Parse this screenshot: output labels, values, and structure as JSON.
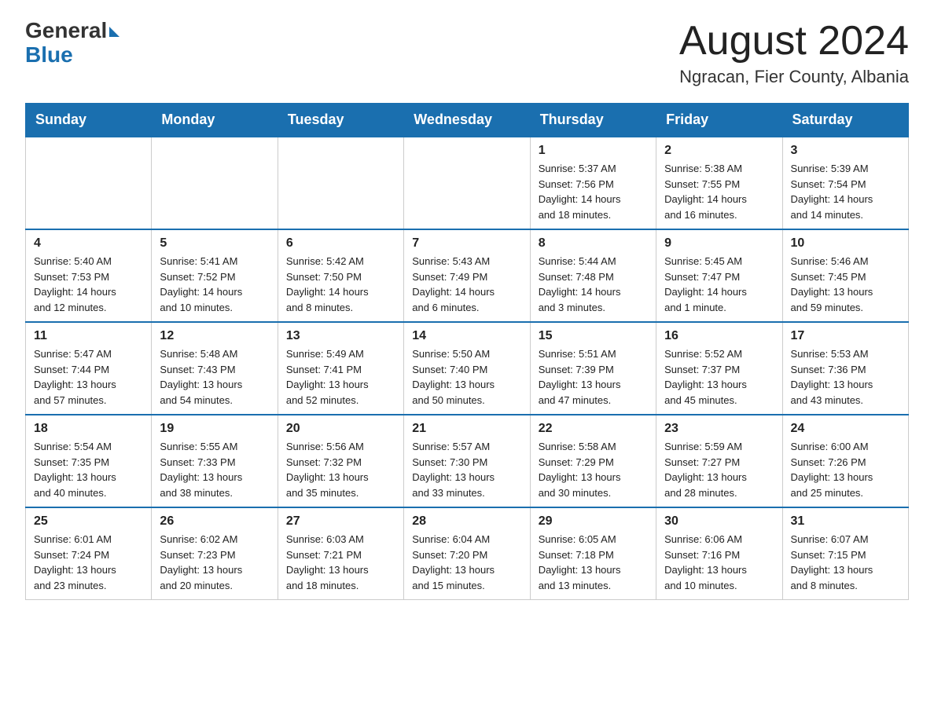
{
  "header": {
    "logo_general": "General",
    "logo_blue": "Blue",
    "month_title": "August 2024",
    "location": "Ngracan, Fier County, Albania"
  },
  "weekdays": [
    "Sunday",
    "Monday",
    "Tuesday",
    "Wednesday",
    "Thursday",
    "Friday",
    "Saturday"
  ],
  "weeks": [
    [
      {
        "day": "",
        "info": ""
      },
      {
        "day": "",
        "info": ""
      },
      {
        "day": "",
        "info": ""
      },
      {
        "day": "",
        "info": ""
      },
      {
        "day": "1",
        "info": "Sunrise: 5:37 AM\nSunset: 7:56 PM\nDaylight: 14 hours\nand 18 minutes."
      },
      {
        "day": "2",
        "info": "Sunrise: 5:38 AM\nSunset: 7:55 PM\nDaylight: 14 hours\nand 16 minutes."
      },
      {
        "day": "3",
        "info": "Sunrise: 5:39 AM\nSunset: 7:54 PM\nDaylight: 14 hours\nand 14 minutes."
      }
    ],
    [
      {
        "day": "4",
        "info": "Sunrise: 5:40 AM\nSunset: 7:53 PM\nDaylight: 14 hours\nand 12 minutes."
      },
      {
        "day": "5",
        "info": "Sunrise: 5:41 AM\nSunset: 7:52 PM\nDaylight: 14 hours\nand 10 minutes."
      },
      {
        "day": "6",
        "info": "Sunrise: 5:42 AM\nSunset: 7:50 PM\nDaylight: 14 hours\nand 8 minutes."
      },
      {
        "day": "7",
        "info": "Sunrise: 5:43 AM\nSunset: 7:49 PM\nDaylight: 14 hours\nand 6 minutes."
      },
      {
        "day": "8",
        "info": "Sunrise: 5:44 AM\nSunset: 7:48 PM\nDaylight: 14 hours\nand 3 minutes."
      },
      {
        "day": "9",
        "info": "Sunrise: 5:45 AM\nSunset: 7:47 PM\nDaylight: 14 hours\nand 1 minute."
      },
      {
        "day": "10",
        "info": "Sunrise: 5:46 AM\nSunset: 7:45 PM\nDaylight: 13 hours\nand 59 minutes."
      }
    ],
    [
      {
        "day": "11",
        "info": "Sunrise: 5:47 AM\nSunset: 7:44 PM\nDaylight: 13 hours\nand 57 minutes."
      },
      {
        "day": "12",
        "info": "Sunrise: 5:48 AM\nSunset: 7:43 PM\nDaylight: 13 hours\nand 54 minutes."
      },
      {
        "day": "13",
        "info": "Sunrise: 5:49 AM\nSunset: 7:41 PM\nDaylight: 13 hours\nand 52 minutes."
      },
      {
        "day": "14",
        "info": "Sunrise: 5:50 AM\nSunset: 7:40 PM\nDaylight: 13 hours\nand 50 minutes."
      },
      {
        "day": "15",
        "info": "Sunrise: 5:51 AM\nSunset: 7:39 PM\nDaylight: 13 hours\nand 47 minutes."
      },
      {
        "day": "16",
        "info": "Sunrise: 5:52 AM\nSunset: 7:37 PM\nDaylight: 13 hours\nand 45 minutes."
      },
      {
        "day": "17",
        "info": "Sunrise: 5:53 AM\nSunset: 7:36 PM\nDaylight: 13 hours\nand 43 minutes."
      }
    ],
    [
      {
        "day": "18",
        "info": "Sunrise: 5:54 AM\nSunset: 7:35 PM\nDaylight: 13 hours\nand 40 minutes."
      },
      {
        "day": "19",
        "info": "Sunrise: 5:55 AM\nSunset: 7:33 PM\nDaylight: 13 hours\nand 38 minutes."
      },
      {
        "day": "20",
        "info": "Sunrise: 5:56 AM\nSunset: 7:32 PM\nDaylight: 13 hours\nand 35 minutes."
      },
      {
        "day": "21",
        "info": "Sunrise: 5:57 AM\nSunset: 7:30 PM\nDaylight: 13 hours\nand 33 minutes."
      },
      {
        "day": "22",
        "info": "Sunrise: 5:58 AM\nSunset: 7:29 PM\nDaylight: 13 hours\nand 30 minutes."
      },
      {
        "day": "23",
        "info": "Sunrise: 5:59 AM\nSunset: 7:27 PM\nDaylight: 13 hours\nand 28 minutes."
      },
      {
        "day": "24",
        "info": "Sunrise: 6:00 AM\nSunset: 7:26 PM\nDaylight: 13 hours\nand 25 minutes."
      }
    ],
    [
      {
        "day": "25",
        "info": "Sunrise: 6:01 AM\nSunset: 7:24 PM\nDaylight: 13 hours\nand 23 minutes."
      },
      {
        "day": "26",
        "info": "Sunrise: 6:02 AM\nSunset: 7:23 PM\nDaylight: 13 hours\nand 20 minutes."
      },
      {
        "day": "27",
        "info": "Sunrise: 6:03 AM\nSunset: 7:21 PM\nDaylight: 13 hours\nand 18 minutes."
      },
      {
        "day": "28",
        "info": "Sunrise: 6:04 AM\nSunset: 7:20 PM\nDaylight: 13 hours\nand 15 minutes."
      },
      {
        "day": "29",
        "info": "Sunrise: 6:05 AM\nSunset: 7:18 PM\nDaylight: 13 hours\nand 13 minutes."
      },
      {
        "day": "30",
        "info": "Sunrise: 6:06 AM\nSunset: 7:16 PM\nDaylight: 13 hours\nand 10 minutes."
      },
      {
        "day": "31",
        "info": "Sunrise: 6:07 AM\nSunset: 7:15 PM\nDaylight: 13 hours\nand 8 minutes."
      }
    ]
  ]
}
